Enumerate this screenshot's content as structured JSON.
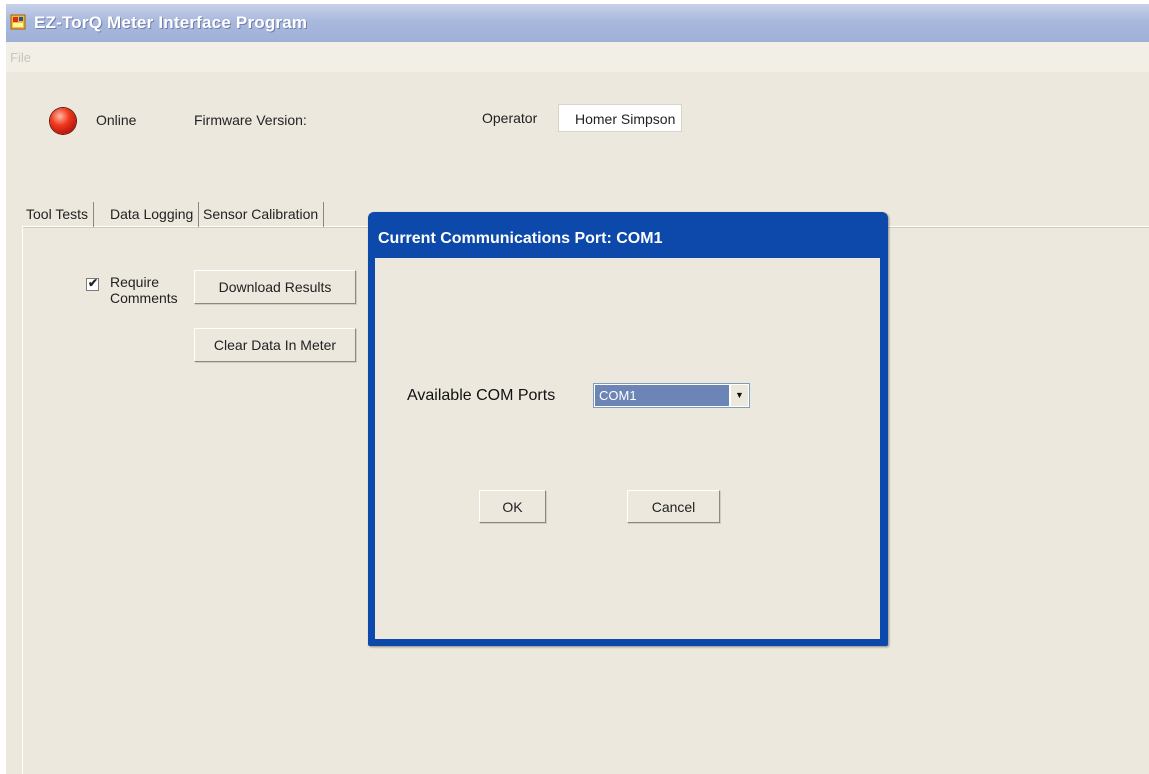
{
  "window": {
    "title": "EZ-TorQ Meter Interface Program"
  },
  "menu": {
    "file": "File"
  },
  "status": {
    "label": "Online",
    "led_color": "#e0301a"
  },
  "firmware": {
    "label": "Firmware Version:",
    "value": ""
  },
  "operator": {
    "label": "Operator",
    "value": "Homer Simpson"
  },
  "tabs": [
    {
      "label": "Tool Tests",
      "active": true
    },
    {
      "label": "Data Logging",
      "active": false
    },
    {
      "label": "Sensor Calibration",
      "active": false
    }
  ],
  "tool_tests": {
    "require_comments": {
      "line1": "Require",
      "line2": "Comments",
      "checked": true
    },
    "download_label": "Download Results",
    "clear_label": "Clear Data In Meter"
  },
  "dialog": {
    "title": "Current Communications Port: COM1",
    "ports_label": "Available COM Ports",
    "selected_port": "COM1",
    "ok_label": "OK",
    "cancel_label": "Cancel"
  },
  "colors": {
    "dialog_frame": "#0c49aa",
    "titlebar": "#a9b8dc",
    "window_bg": "#ece8dd",
    "combo_selected": "#6d84b7"
  }
}
